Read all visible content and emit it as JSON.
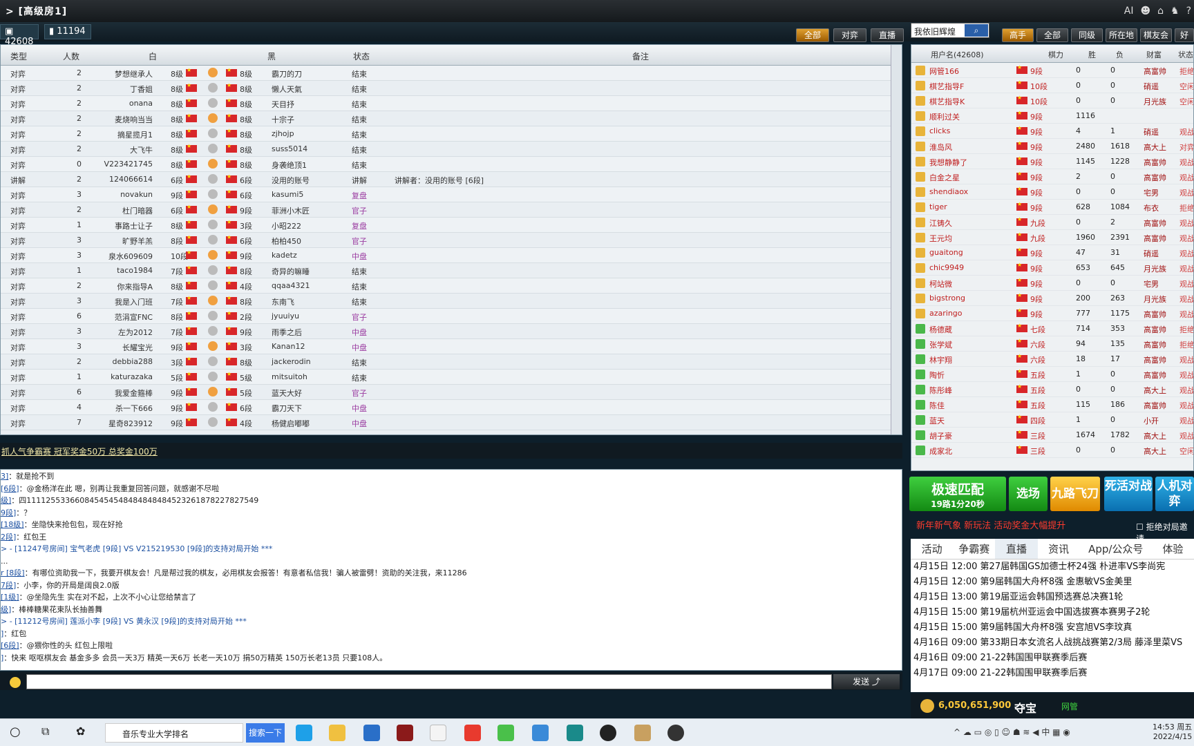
{
  "window": {
    "title": "> [高级房1]",
    "right_icons": [
      "AI",
      "user-icon",
      "home-icon",
      "shirt-icon",
      "help-icon"
    ]
  },
  "stats": {
    "online": "42608",
    "games": "11194"
  },
  "filters": {
    "game": [
      "全部",
      "对弈",
      "直播"
    ],
    "search_placeholder": "我依旧辉煌",
    "player": [
      "高手",
      "全部",
      "同级",
      "所在地",
      "棋友会",
      "好"
    ]
  },
  "game_headers": [
    "类型",
    "人数",
    "白",
    "黑",
    "状态",
    "备注"
  ],
  "games": [
    [
      "对弈",
      "2",
      "梦想继承人",
      "8级",
      "8级",
      "霸刀的刀",
      "结束",
      ""
    ],
    [
      "对弈",
      "2",
      "丁香姐",
      "8级",
      "8级",
      "懒人天氣",
      "结束",
      ""
    ],
    [
      "对弈",
      "2",
      "onana",
      "8级",
      "8级",
      "天目抒",
      "结束",
      ""
    ],
    [
      "对弈",
      "2",
      "麦烧响当当",
      "8级",
      "8级",
      "十宗子",
      "结束",
      ""
    ],
    [
      "对弈",
      "2",
      "摘星揽月1",
      "8级",
      "8级",
      "zjhojp",
      "结束",
      ""
    ],
    [
      "对弈",
      "2",
      "大飞牛",
      "8级",
      "8级",
      "suss5014",
      "结束",
      ""
    ],
    [
      "对弈",
      "0",
      "V223421745",
      "8级",
      "8级",
      "身袭绝顶1",
      "结束",
      ""
    ],
    [
      "讲解",
      "2",
      "124066614",
      "6段",
      "6段",
      "没用的账号",
      "讲解",
      "讲解者：没用的账号 [6段]"
    ],
    [
      "对弈",
      "3",
      "novakun",
      "9段",
      "6段",
      "kasumi5",
      "复盘",
      ""
    ],
    [
      "对弈",
      "2",
      "杜门暗器",
      "6段",
      "9段",
      "菲洲小木匠",
      "官子",
      ""
    ],
    [
      "对弈",
      "1",
      "事路士让子",
      "8级",
      "3段",
      "小昭222",
      "复盘",
      ""
    ],
    [
      "对弈",
      "3",
      "旷野羊羔",
      "8段",
      "6段",
      "柏柏450",
      "官子",
      ""
    ],
    [
      "对弈",
      "3",
      "泉水609609",
      "10段",
      "9段",
      "kadetz",
      "中盘",
      ""
    ],
    [
      "对弈",
      "1",
      "taco1984",
      "7段",
      "8段",
      "奇异的嘛睡",
      "结束",
      ""
    ],
    [
      "对弈",
      "2",
      "你来指导A",
      "8级",
      "4段",
      "qqaa4321",
      "结束",
      ""
    ],
    [
      "对弈",
      "3",
      "我是入门班",
      "7段",
      "8段",
      "东南飞",
      "结束",
      ""
    ],
    [
      "对弈",
      "6",
      "范涓宣FNC",
      "8段",
      "2段",
      "jyuuiyu",
      "官子",
      ""
    ],
    [
      "对弈",
      "3",
      "左为2012",
      "7段",
      "9段",
      "雨季之后",
      "中盘",
      ""
    ],
    [
      "对弈",
      "3",
      "长耀宝光",
      "9段",
      "3段",
      "Kanan12",
      "中盘",
      ""
    ],
    [
      "对弈",
      "2",
      "debbia288",
      "3段",
      "8级",
      "jackerodin",
      "结束",
      ""
    ],
    [
      "对弈",
      "1",
      "katurazaka",
      "5段",
      "5级",
      "mitsuitoh",
      "结束",
      ""
    ],
    [
      "对弈",
      "6",
      "我爱金箍棒",
      "9段",
      "5段",
      "蓝天大好",
      "官子",
      ""
    ],
    [
      "对弈",
      "4",
      "杀一下666",
      "9段",
      "6段",
      "霸刀天下",
      "中盘",
      ""
    ],
    [
      "对弈",
      "7",
      "星奇823912",
      "9段",
      "4段",
      "杨健启嘟嘟",
      "中盘",
      ""
    ]
  ],
  "banner": "抓人气争霸赛 冠军奖金50万 总奖金100万",
  "chat": [
    {
      "n": "3]",
      "t": "：就是抢不到"
    },
    {
      "n": "[6段]",
      "t": "：@金杨洋在此  嗯，别再让我重复回答问题，就感谢不尽啦"
    },
    {
      "n": "级]",
      "t": "：四111125533660845454548484848484523261878227827549"
    },
    {
      "n": "9段]",
      "t": "：？"
    },
    {
      "n": "[18级]",
      "t": "：坐隐快来抢包包，现在好抢"
    },
    {
      "n": "2段]",
      "t": "：红包王"
    },
    {
      "n": "",
      "t": "> - [11247号房间] 宝气老虎 [9段] VS V215219530 [9段]的支持对局开始 ***",
      "sys": true
    },
    {
      "n": "",
      "t": "..."
    },
    {
      "n": "r [8段]",
      "t": "：有哪位资助我一下，我要开棋友会！凡是帮过我的棋友，必用棋友会报答！有意者私信我！骗人被雷劈！资助的关注我，来11286"
    },
    {
      "n": "7段]",
      "t": "：小李，你的开局是阔良2.0版"
    },
    {
      "n": "[1级]",
      "t": "：@坐隐先生  实在对不起，上次不小心让您给禁言了"
    },
    {
      "n": "级]",
      "t": "：棒棒糖果花束队长抽善舞"
    },
    {
      "n": "",
      "t": "> - [11212号房间] 莲派小李 [9段] VS 黄永汉 [9段]的支持对局开始 ***",
      "sys": true
    },
    {
      "n": "]",
      "t": "：红包"
    },
    {
      "n": "[6段]",
      "t": "：@猥你性的头  红包上限啦"
    },
    {
      "n": "]",
      "t": "：快来 呕呕棋友会 基金多多 会员一天3万 精英一天6万 长老一天10万 捐50万精英 150万长老13员 只要108人。"
    }
  ],
  "send": "发送",
  "player_headers": [
    "用户名(42608)",
    "棋力",
    "胜",
    "负",
    "财富",
    "状态"
  ],
  "players": [
    [
      "网管166",
      "9段",
      "0",
      "0",
      "高富帅",
      "拒绝"
    ],
    [
      "棋艺指导F",
      "10段",
      "0",
      "0",
      "硝遥",
      "空闲"
    ],
    [
      "棋艺指导K",
      "10段",
      "0",
      "0",
      "月光族",
      "空闲"
    ],
    [
      "顺利过关",
      "9段",
      "1116",
      "",
      "",
      ""
    ],
    [
      "clicks",
      "9段",
      "4",
      "1",
      "硝遥",
      "观战"
    ],
    [
      "淮岛风",
      "9段",
      "2480",
      "1618",
      "高大上",
      "对弈"
    ],
    [
      "我想静静了",
      "9段",
      "1145",
      "1228",
      "高富帅",
      "观战"
    ],
    [
      "白金之星",
      "9段",
      "2",
      "0",
      "高富帅",
      "观战"
    ],
    [
      "shendiaox",
      "9段",
      "0",
      "0",
      "宅男",
      "观战"
    ],
    [
      "tiger",
      "9段",
      "628",
      "1084",
      "布衣",
      "拒绝"
    ],
    [
      "江铸久",
      "九段",
      "0",
      "2",
      "高富帅",
      "观战"
    ],
    [
      "王元均",
      "九段",
      "1960",
      "2391",
      "高富帅",
      "观战"
    ],
    [
      "guaitong",
      "9段",
      "47",
      "31",
      "硝遥",
      "观战"
    ],
    [
      "chic9949",
      "9段",
      "653",
      "645",
      "月光族",
      "观战"
    ],
    [
      "柯站微",
      "9段",
      "0",
      "0",
      "宅男",
      "观战"
    ],
    [
      "bigstrong",
      "9段",
      "200",
      "263",
      "月光族",
      "观战"
    ],
    [
      "azaringo",
      "9段",
      "777",
      "1175",
      "高富帅",
      "观战"
    ],
    [
      "杨德蔵",
      "七段",
      "714",
      "353",
      "高富帅",
      "拒绝"
    ],
    [
      "张学斌",
      "六段",
      "94",
      "135",
      "高富帅",
      "拒绝"
    ],
    [
      "林宇翔",
      "六段",
      "18",
      "17",
      "高富帅",
      "观战"
    ],
    [
      "陶忻",
      "五段",
      "1",
      "0",
      "高富帅",
      "观战"
    ],
    [
      "陈彤峰",
      "五段",
      "0",
      "0",
      "高大上",
      "观战"
    ],
    [
      "陈佳",
      "五段",
      "115",
      "186",
      "高富帅",
      "观战"
    ],
    [
      "蓝天",
      "四段",
      "1",
      "0",
      "小开",
      "观战"
    ],
    [
      "胡子豪",
      "三段",
      "1674",
      "1782",
      "高大上",
      "观战"
    ],
    [
      "成家北",
      "三段",
      "0",
      "0",
      "高大上",
      "空闲"
    ]
  ],
  "actions": {
    "match": "极速匹配",
    "match_sub": "19路1分20秒",
    "field": "选场",
    "nine": "九路飞刀",
    "life": "死活对战",
    "ai": "人机对弈"
  },
  "promo": "新年新气象 新玩法 活动奖金大幅提升",
  "reject": "拒绝对局邀请",
  "tabs": [
    "活动",
    "争霸赛",
    "直播",
    "资讯",
    "App/公众号",
    "体验"
  ],
  "news": [
    "4月15日 12:00 第27届韩国GS加德士杯24强 朴进率VS李尚宪",
    "4月15日 12:00 第9届韩国大舟杯8强 金惠敏VS金美里",
    "4月15日 13:00 第19届亚运会韩国预选赛总决赛1轮",
    "4月15日 15:00 第19届杭州亚运会中国选拔赛本赛男子2轮",
    "4月15日 15:00 第9届韩国大舟杯8强 安宫旭VS李玟真",
    "4月16日 09:00 第33期日本女流名人战挑战赛第2/3局 藤泽里菜VS",
    "4月16日 09:00 21-22韩国围甲联赛季后赛",
    "4月17日 09:00 21-22韩国围甲联赛季后赛"
  ],
  "wealth": "6,050,651,900",
  "treasure": "夺宝",
  "netadmin": "网管",
  "taskbar": {
    "search_text": "音乐专业大学排名",
    "search_btn": "搜索一下",
    "time": "14:53 周五",
    "date": "2022/4/15"
  }
}
